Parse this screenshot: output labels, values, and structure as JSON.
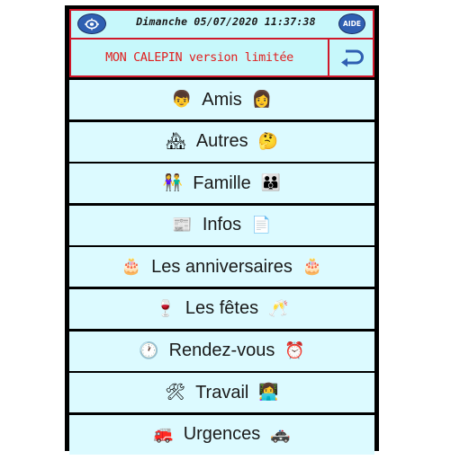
{
  "header": {
    "datetime": "Dimanche 05/07/2020 11:37:38",
    "help_label": "AIDE",
    "settings_icon": "gear-icon",
    "title": "MON CALEPIN version limitée",
    "back_icon": "return-arrow-icon"
  },
  "colors": {
    "accent_red": "#d0182a",
    "title_red": "#e02020",
    "panel_bg": "#c7f8fb",
    "item_bg": "#dcfaff",
    "button_blue": "#2f5fb2"
  },
  "menu": {
    "items": [
      {
        "label": "Amis",
        "left_icon": "👦",
        "right_icon": "👩"
      },
      {
        "label": "Autres",
        "left_icon": "🏘",
        "right_icon": "🤔"
      },
      {
        "label": "Famille",
        "left_icon": "👫",
        "right_icon": "👪"
      },
      {
        "label": "Infos",
        "left_icon": "📰",
        "right_icon": "📄"
      },
      {
        "label": "Les anniversaires",
        "left_icon": "🎂",
        "right_icon": "🎂"
      },
      {
        "label": "Les fêtes",
        "left_icon": "🍷",
        "right_icon": "🥂"
      },
      {
        "label": "Rendez-vous",
        "left_icon": "🕐",
        "right_icon": "⏰"
      },
      {
        "label": "Travail",
        "left_icon": "🛠",
        "right_icon": "👩‍💻"
      },
      {
        "label": "Urgences",
        "left_icon": "🚒",
        "right_icon": "🚓"
      }
    ]
  }
}
